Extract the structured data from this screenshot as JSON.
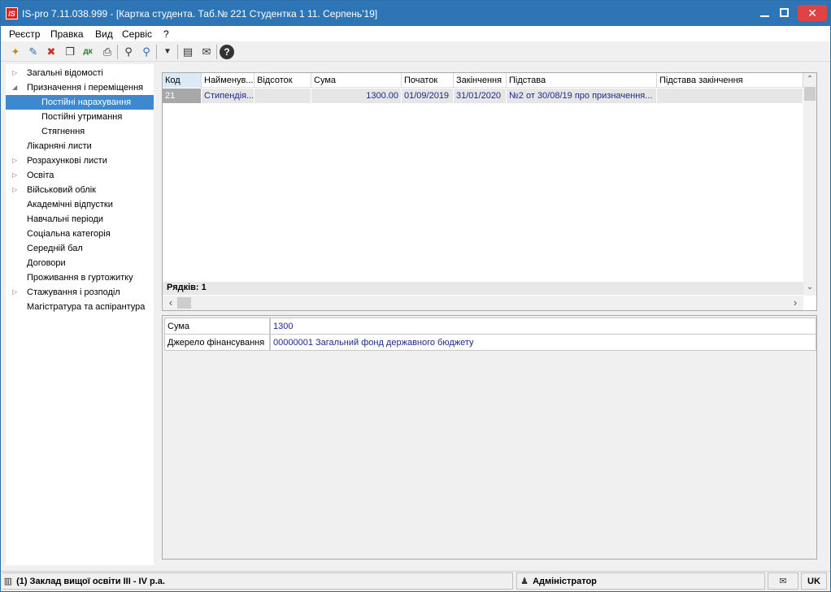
{
  "window": {
    "logo": "IS",
    "title": "IS-pro 7.11.038.999 - [Картка студента. Таб.№ 221 Студентка 1 11. Серпень'19]",
    "close_glyph": "✕"
  },
  "menu": [
    "Реєстр",
    "Правка",
    "Вид",
    "Сервіс",
    "?"
  ],
  "toolbar": {
    "icons": [
      "new-doc-icon",
      "edit-doc-icon",
      "delete-doc-icon",
      "copy-doc-icon",
      "dk-icon",
      "print-icon",
      "search-icon",
      "search-next-icon",
      "filter-icon",
      "form-icon",
      "mail-icon",
      "help-icon"
    ],
    "glyphs": {
      "new": "✦",
      "edit": "✎",
      "delete": "✖",
      "copy": "❐",
      "dk": "дк",
      "print": "⎙",
      "search": "⚲",
      "search_next": "⚲",
      "filter": "▼",
      "form": "▤",
      "mail": "✉",
      "help": "?"
    }
  },
  "tree": {
    "items": [
      {
        "label": "Загальні відомості",
        "expander": "▷",
        "level": 0
      },
      {
        "label": "Призначення і переміщення",
        "expander": "◢",
        "level": 0
      },
      {
        "label": "Постійні нарахування",
        "expander": "",
        "level": 1,
        "selected": true
      },
      {
        "label": "Постійні утримання",
        "expander": "",
        "level": 1
      },
      {
        "label": "Стягнення",
        "expander": "",
        "level": 1
      },
      {
        "label": "Лікарняні листи",
        "expander": "",
        "level": 0
      },
      {
        "label": "Розрахункові листи",
        "expander": "▷",
        "level": 0
      },
      {
        "label": "Освіта",
        "expander": "▷",
        "level": 0
      },
      {
        "label": "Військовий облік",
        "expander": "▷",
        "level": 0
      },
      {
        "label": "Академічні відпустки",
        "expander": "",
        "level": 0
      },
      {
        "label": "Навчальні періоди",
        "expander": "",
        "level": 0
      },
      {
        "label": "Соціальна категорія",
        "expander": "",
        "level": 0
      },
      {
        "label": "Середній бал",
        "expander": "",
        "level": 0
      },
      {
        "label": "Договори",
        "expander": "",
        "level": 0
      },
      {
        "label": "Проживання в гуртожитку",
        "expander": "",
        "level": 0
      },
      {
        "label": "Стажування і розподіл",
        "expander": "▷",
        "level": 0
      },
      {
        "label": "Магістратура та аспірантура",
        "expander": "",
        "level": 0
      }
    ]
  },
  "grid": {
    "columns": [
      "Код",
      "Найменув...",
      "Відсоток",
      "Сума",
      "Початок",
      "Закінчення",
      "Підстава",
      "Підстава закінчення"
    ],
    "rows": [
      [
        "21",
        "Стипендія...",
        "",
        "1300.00",
        "01/09/2019",
        "31/01/2020",
        "№2 от 30/08/19 про призначення...",
        ""
      ]
    ],
    "row_count_label": "Рядків: 1",
    "scroll_up": "⌃",
    "scroll_down": "⌄",
    "scroll_left": "‹",
    "scroll_right": "›"
  },
  "detail": {
    "fields": [
      {
        "label": "Сума",
        "value": "1300"
      },
      {
        "label": "Джерело фінансування",
        "value": "00000001 Загальний фонд державного бюджету"
      }
    ]
  },
  "status": {
    "organization": "(1) Заклад вищої освіти III - IV р.а.",
    "user": "Адміністратор",
    "language": "UK",
    "org_icon": "▥",
    "user_icon": "♟",
    "mail_icon": "✉"
  }
}
